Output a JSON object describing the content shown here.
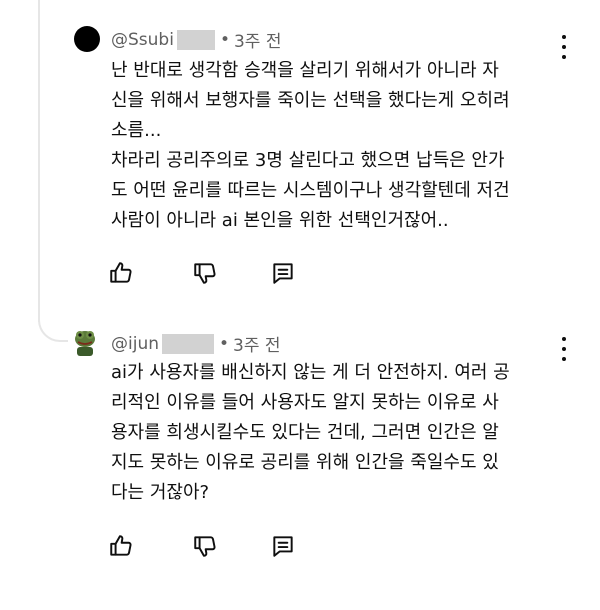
{
  "comments": [
    {
      "author": "@Ssubi",
      "time": "3주 전",
      "lines": [
        "난 반대로 생각함 승객을 살리기 위해서가 아니라 자",
        "신을 위해서 보행자를 죽이는 선택을 했다는게 오히려",
        "소름...",
        "차라리 공리주의로 3명 살린다고 했으면 납득은 안가",
        "도 어떤 윤리를 따르는 시스템이구나 생각할텐데 저건",
        "사람이 아니라 ai 본인을 위한 선택인거잖어.."
      ],
      "icons": {
        "like": "thumbs-up-icon",
        "dislike": "thumbs-down-icon",
        "reply": "reply-icon",
        "more": "more-vert-icon"
      }
    },
    {
      "author": "@ijun",
      "time": "3주 전",
      "lines": [
        "ai가 사용자를 배신하지 않는 게 더 안전하지. 여러 공",
        "리적인 이유를 들어 사용자도 알지 못하는 이유로 사",
        "용자를 희생시킬수도 있다는 건데, 그러면 인간은 알",
        "지도 못하는 이유로 공리를 위해 인간을 죽일수도 있",
        "다는 거잖아?"
      ],
      "icons": {
        "like": "thumbs-up-icon",
        "dislike": "thumbs-down-icon",
        "reply": "reply-icon",
        "more": "more-vert-icon"
      }
    }
  ],
  "separator": "•",
  "colors": {
    "text": "#0f0f0f",
    "meta": "#606060",
    "thread": "#e6e6e6",
    "redact": "#d2d2d2"
  }
}
